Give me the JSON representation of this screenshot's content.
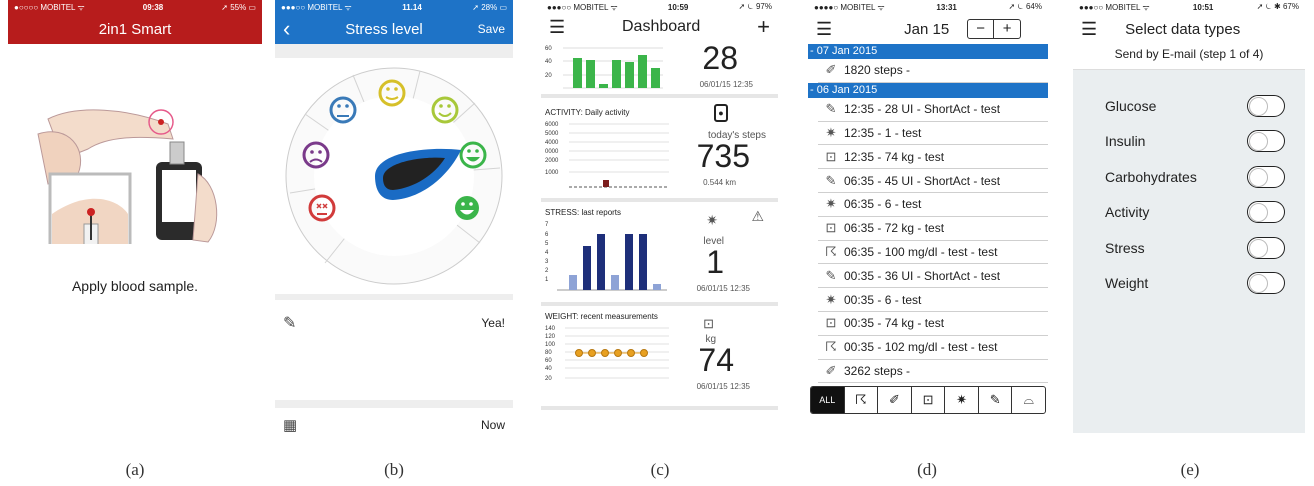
{
  "a": {
    "status": {
      "carrier": "●○○○○ MOBITEL ᯤ",
      "time": "09:38",
      "battery": "➚ 55% ▭"
    },
    "title": "2in1 Smart",
    "instruction": "Apply blood sample.",
    "caption": "(a)"
  },
  "b": {
    "status": {
      "carrier": "●●●○○ MOBITEL ᯤ",
      "time": "11.14",
      "battery": "➚ 28% ▭"
    },
    "back": "‹",
    "title": "Stress level",
    "save": "Save",
    "note_value": "Yea!",
    "date_value": "Now",
    "caption": "(b)"
  },
  "c": {
    "status": {
      "carrier": "●●●○○ MOBITEL ᯤ",
      "time": "10:59",
      "battery": "➚ ⏾ 97%"
    },
    "title": "Dashboard",
    "plus": "+",
    "glucose": {
      "value": "28",
      "timestamp": "06/01/15 12:35",
      "yticks": [
        "60",
        "40",
        "20"
      ]
    },
    "activity": {
      "label": "ACTIVITY: Daily activity",
      "sub": "today's steps",
      "value": "735",
      "distance": "0.544 km",
      "yticks": [
        "6000",
        "5000",
        "4000",
        "0000",
        "2000",
        "1000"
      ]
    },
    "stress": {
      "label": "STRESS: last reports",
      "sub": "level",
      "value": "1",
      "timestamp": "06/01/15 12:35",
      "yticks": [
        "7",
        "6",
        "5",
        "4",
        "3",
        "2",
        "1"
      ]
    },
    "weight": {
      "label": "WEIGHT: recent measurements",
      "sub": "kg",
      "value": "74",
      "timestamp": "06/01/15 12:35",
      "yticks": [
        "140",
        "120",
        "100",
        "80",
        "60",
        "40",
        "20"
      ]
    },
    "caption": "(c)"
  },
  "d": {
    "status": {
      "carrier": "●●●●○ MOBITEL ᯤ",
      "time": "13:31",
      "battery": "➚ ⏾ 64%"
    },
    "date": "Jan 15",
    "minus": "−",
    "plus": "+",
    "entries": [
      {
        "type": "header",
        "text": "- 07 Jan 2015"
      },
      {
        "type": "row",
        "icon": "shoe-icon",
        "glyph": "✐",
        "text": "1820 steps -"
      },
      {
        "type": "header",
        "text": "- 06 Jan 2015"
      },
      {
        "type": "row",
        "icon": "syringe-icon",
        "glyph": "✎",
        "text": "12:35 - 28 UI - ShortAct - test"
      },
      {
        "type": "row",
        "icon": "stress-icon",
        "glyph": "✷",
        "text": "12:35 - 1 - test"
      },
      {
        "type": "row",
        "icon": "scale-icon",
        "glyph": "⊡",
        "text": "12:35 - 74 kg - test"
      },
      {
        "type": "row",
        "icon": "syringe-icon",
        "glyph": "✎",
        "text": "06:35 - 45 UI - ShortAct - test"
      },
      {
        "type": "row",
        "icon": "stress-icon",
        "glyph": "✷",
        "text": "06:35 - 6 - test"
      },
      {
        "type": "row",
        "icon": "scale-icon",
        "glyph": "⊡",
        "text": "06:35 - 72 kg - test"
      },
      {
        "type": "row",
        "icon": "glucose-meter-icon",
        "glyph": "☈",
        "text": "06:35 - 100 mg/dl - test - test"
      },
      {
        "type": "row",
        "icon": "syringe-icon",
        "glyph": "✎",
        "text": "00:35 - 36 UI - ShortAct - test"
      },
      {
        "type": "row",
        "icon": "stress-icon",
        "glyph": "✷",
        "text": "00:35 - 6 - test"
      },
      {
        "type": "row",
        "icon": "scale-icon",
        "glyph": "⊡",
        "text": "00:35 - 74 kg - test"
      },
      {
        "type": "row",
        "icon": "glucose-meter-icon",
        "glyph": "☈",
        "text": "00:35 - 102 mg/dl - test - test"
      },
      {
        "type": "row",
        "icon": "shoe-icon",
        "glyph": "✐",
        "text": "3262 steps -"
      }
    ],
    "filter_all": "ALL",
    "caption": "(d)"
  },
  "e": {
    "status": {
      "carrier": "●●●○○ MOBITEL ᯤ",
      "time": "10:51",
      "battery": "➚ ⏾ ✱ 67%"
    },
    "title": "Select data types",
    "subtitle": "Send by E-mail (step 1 of 4)",
    "types": [
      "Glucose",
      "Insulin",
      "Carbohydrates",
      "Activity",
      "Stress",
      "Weight"
    ],
    "caption": "(e)"
  },
  "colors": {
    "red": "#b71c1c",
    "blue": "#1e73c7",
    "green": "#3bb54a",
    "navy": "#1e2f7a",
    "lightblue": "#8ea3d6",
    "orange": "#e8a020",
    "darkred": "#7a1c1c"
  }
}
